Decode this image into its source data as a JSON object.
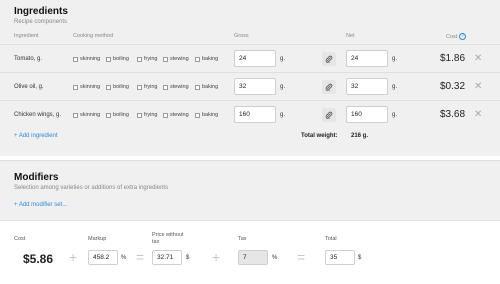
{
  "ingredients": {
    "title": "Ingredients",
    "subtitle": "Recipe components",
    "columns": {
      "ingredient": "Ingredient",
      "method": "Cooking method",
      "gross": "Gross",
      "net": "Net",
      "cost": "Cost"
    },
    "methods": [
      "skinning",
      "boiling",
      "frying",
      "stewing",
      "baking"
    ],
    "rows": [
      {
        "name": "Tomato, g.",
        "gross": "24",
        "gross_unit": "g.",
        "net": "24",
        "net_unit": "g.",
        "cost": "$1.86"
      },
      {
        "name": "Olive oil, g.",
        "gross": "32",
        "gross_unit": "g.",
        "net": "32",
        "net_unit": "g.",
        "cost": "$0.32"
      },
      {
        "name": "Chicken wings, g.",
        "gross": "160",
        "gross_unit": "g.",
        "net": "160",
        "net_unit": "g.",
        "cost": "$3.68"
      }
    ],
    "add_label": "+ Add ingredient",
    "total_label": "Total weight:",
    "total_value": "216 g."
  },
  "modifiers": {
    "title": "Modifiers",
    "subtitle": "Selection among varieties or additions of extra ingredients",
    "add_label": "+ Add modifier set..."
  },
  "calc": {
    "cost_label": "Cost",
    "cost_value": "$5.86",
    "markup_label": "Markup",
    "markup_value": "458.2",
    "markup_unit": "%",
    "price_label_1": "Price without",
    "price_label_2": "tax",
    "price_value": "32.71",
    "price_unit": "$",
    "tax_label": "Tax",
    "tax_value": "7",
    "tax_unit": "%",
    "total_label": "Total",
    "total_value": "35",
    "total_unit": "$",
    "plus": "+",
    "equals": "=",
    "help": "?",
    "delete": "✕"
  },
  "colors": {
    "accent": "#2b8ad8",
    "panel": "#f0f0f0",
    "operator": "#c8c8c8"
  }
}
